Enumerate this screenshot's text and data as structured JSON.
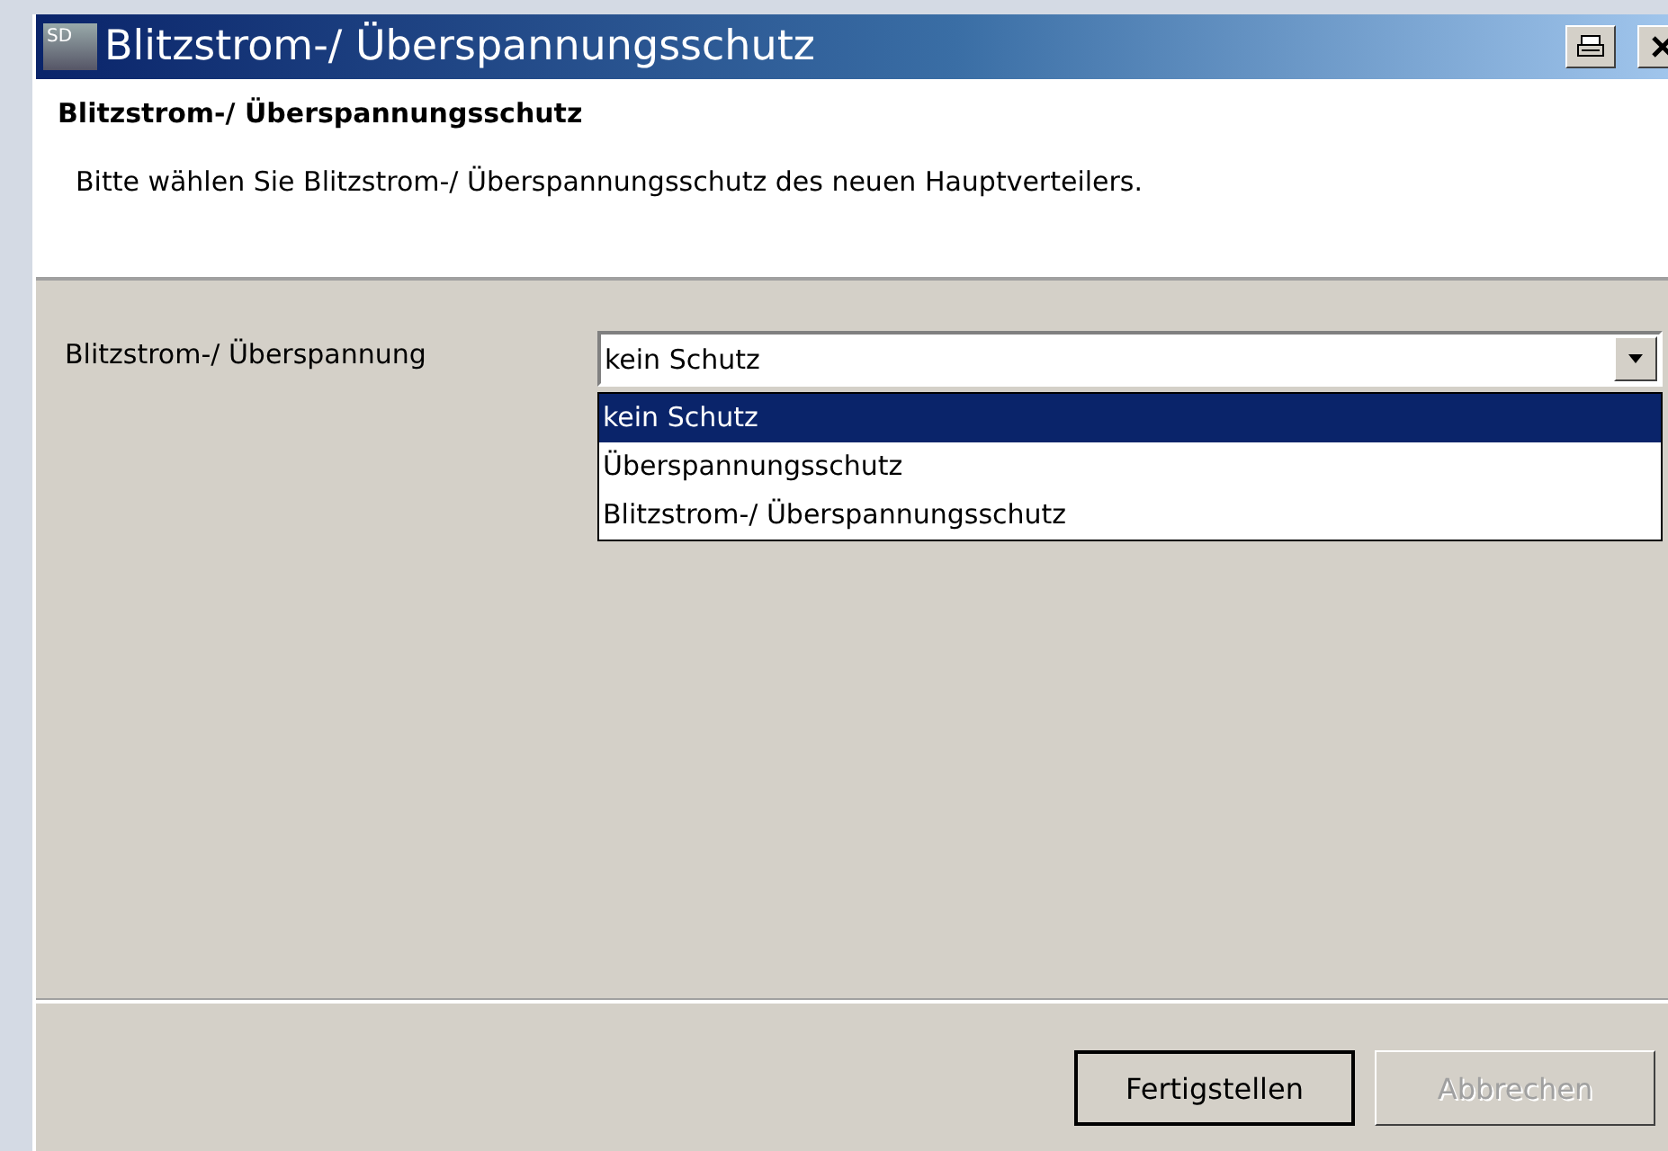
{
  "window": {
    "title": "Blitzstrom-/ Überspannungsschutz",
    "logo": "SD"
  },
  "header": {
    "title": "Blitzstrom-/ Überspannungsschutz",
    "description": "Bitte wählen Sie Blitzstrom-/ Überspannungsschutz des neuen Hauptverteilers."
  },
  "field": {
    "label": "Blitzstrom-/ Überspannung",
    "value": "kein Schutz",
    "expanded": true,
    "options": [
      {
        "label": "kein Schutz",
        "selected": true
      },
      {
        "label": "Überspannungsschutz",
        "selected": false
      },
      {
        "label": "Blitzstrom-/ Überspannungsschutz",
        "selected": false
      }
    ]
  },
  "buttons": [
    {
      "label": "Fertigstellen",
      "disabled": false
    },
    {
      "label": "Abbrechen",
      "disabled": true
    }
  ]
}
